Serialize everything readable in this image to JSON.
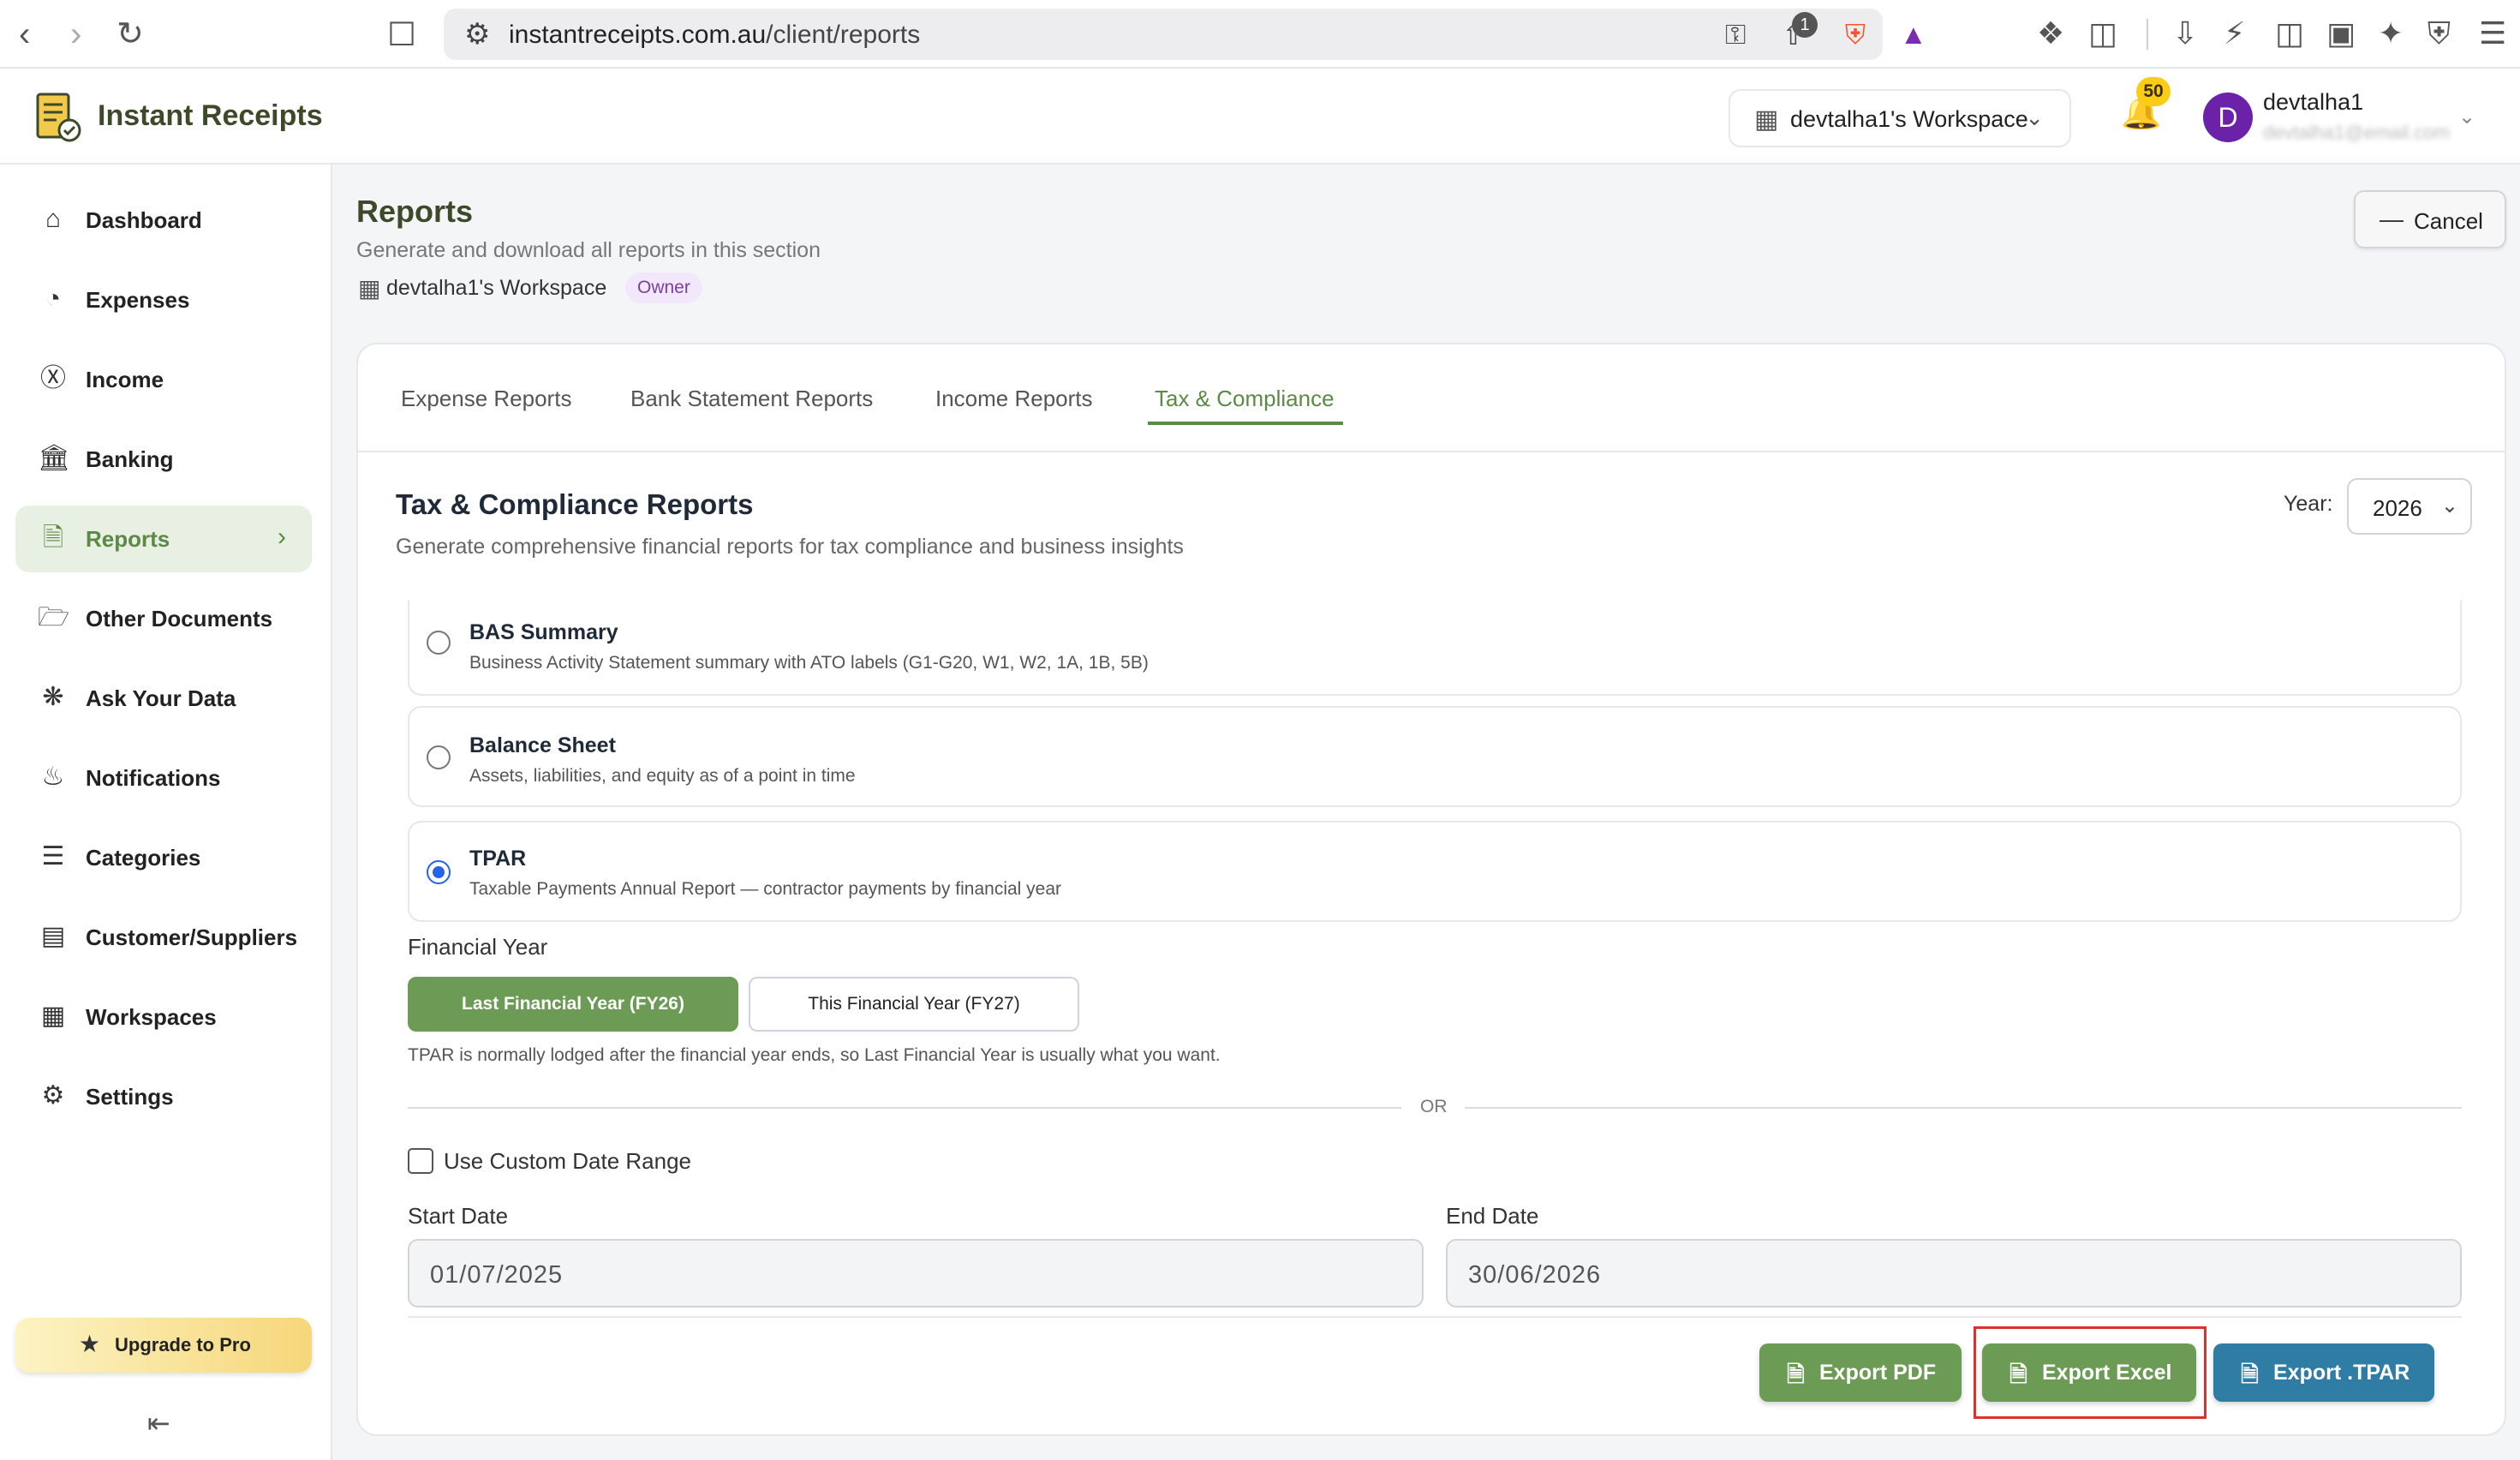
{
  "browser": {
    "url_host": "instantreceipts.com.au",
    "url_path": "/client/reports",
    "extension_badge": "1"
  },
  "header": {
    "brand": "Instant Receipts",
    "workspace_selector": "devtalha1's Workspace",
    "notification_count": "50",
    "user_initial": "D",
    "user_name": "devtalha1",
    "user_email": "devtalha1@email.com"
  },
  "sidebar": {
    "items": [
      {
        "label": "Dashboard",
        "icon": "home-icon"
      },
      {
        "label": "Expenses",
        "icon": "pie-chart-icon"
      },
      {
        "label": "Income",
        "icon": "dollar-circle-icon"
      },
      {
        "label": "Banking",
        "icon": "bank-icon"
      },
      {
        "label": "Reports",
        "icon": "document-icon",
        "active": true
      },
      {
        "label": "Other Documents",
        "icon": "folder-icon"
      },
      {
        "label": "Ask Your Data",
        "icon": "ai-icon"
      },
      {
        "label": "Notifications",
        "icon": "bell-icon"
      },
      {
        "label": "Categories",
        "icon": "list-icon"
      },
      {
        "label": "Customer/Suppliers",
        "icon": "contact-icon"
      },
      {
        "label": "Workspaces",
        "icon": "building-icon"
      },
      {
        "label": "Settings",
        "icon": "gear-icon"
      }
    ],
    "upgrade_label": "Upgrade to Pro"
  },
  "page": {
    "title": "Reports",
    "subtitle": "Generate and download all reports in this section",
    "workspace": "devtalha1's Workspace",
    "role_badge": "Owner",
    "cancel_label": "Cancel"
  },
  "tabs": [
    {
      "label": "Expense Reports"
    },
    {
      "label": "Bank Statement Reports"
    },
    {
      "label": "Income Reports"
    },
    {
      "label": "Tax & Compliance",
      "active": true
    }
  ],
  "section": {
    "title": "Tax & Compliance Reports",
    "subtitle": "Generate comprehensive financial reports for tax compliance and business insights",
    "year_label": "Year:",
    "year_value": "2026"
  },
  "report_options": [
    {
      "title": "BAS Summary",
      "description": "Business Activity Statement summary with ATO labels (G1-G20, W1, W2, 1A, 1B, 5B)",
      "selected": false
    },
    {
      "title": "Balance Sheet",
      "description": "Assets, liabilities, and equity as of a point in time",
      "selected": false
    },
    {
      "title": "TPAR",
      "description": "Taxable Payments Annual Report — contractor payments by financial year",
      "selected": true
    }
  ],
  "financial_year": {
    "label": "Financial Year",
    "last_fy": "Last Financial Year (FY26)",
    "this_fy": "This Financial Year (FY27)",
    "selected": "last_fy",
    "note": "TPAR is normally lodged after the financial year ends, so Last Financial Year is usually what you want.",
    "or_text": "OR"
  },
  "custom_range": {
    "checkbox_label": "Use Custom Date Range",
    "checked": false,
    "start_label": "Start Date",
    "start_value": "01/07/2025",
    "end_label": "End Date",
    "end_value": "30/06/2026"
  },
  "actions": {
    "export_pdf": "Export PDF",
    "export_excel": "Export Excel",
    "export_tpar": "Export .TPAR"
  },
  "colors": {
    "accent_green": "#6b9b54",
    "tpar_blue": "#2f7ca5",
    "highlight_red": "#e0302b"
  }
}
